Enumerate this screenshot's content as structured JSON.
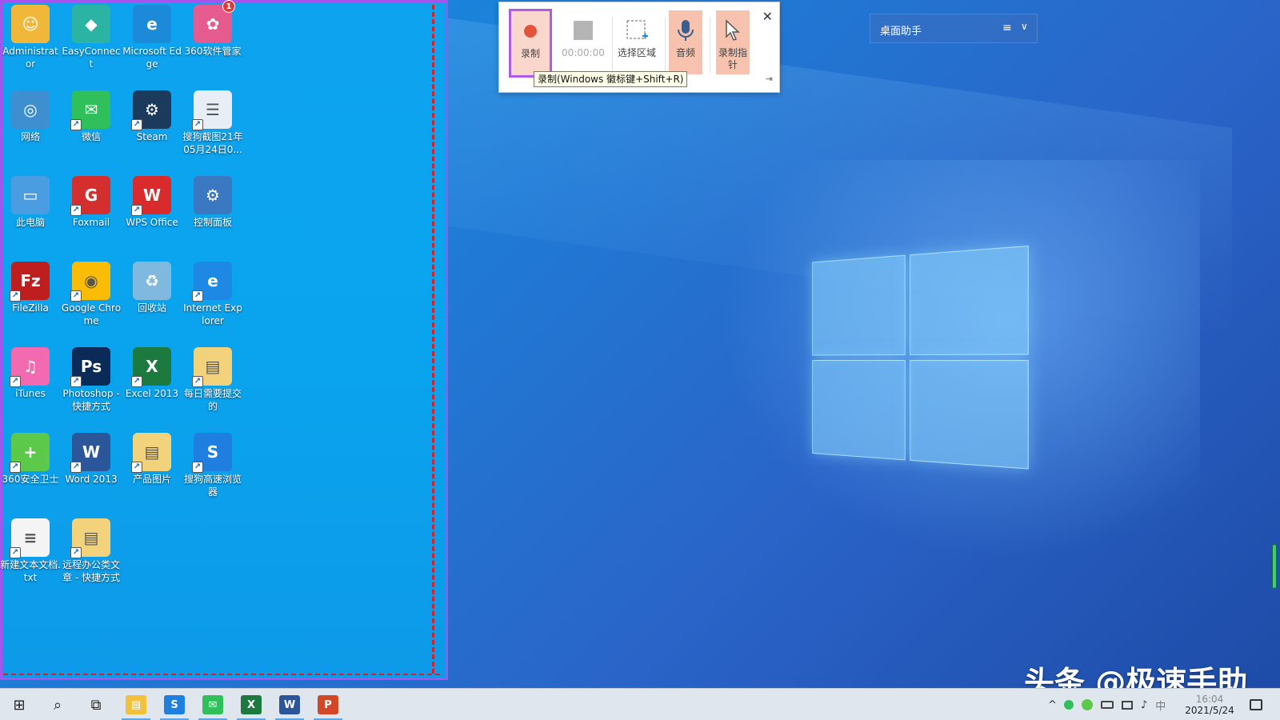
{
  "desktop": {
    "icons": [
      {
        "label": "Administrator",
        "color": "#f0b73a",
        "glyph": "☺"
      },
      {
        "label": "EasyConnect",
        "color": "#2bb3a3",
        "glyph": "◆"
      },
      {
        "label": "Microsoft Edge",
        "color": "#1b8ad8",
        "glyph": "e"
      },
      {
        "label": "360软件管家",
        "color": "#e55a8f",
        "glyph": "✿",
        "badge": "1"
      },
      {
        "label": "网络",
        "color": "#3d8fd0",
        "glyph": "◎"
      },
      {
        "label": "微信",
        "color": "#2fc05b",
        "glyph": "✉"
      },
      {
        "label": "Steam",
        "color": "#1b3a5c",
        "glyph": "⚙"
      },
      {
        "label": "搜狗截图21年05月24日0...",
        "color": "#e8eef5",
        "glyph": "☰"
      },
      {
        "label": "此电脑",
        "color": "#4a9de0",
        "glyph": "▭"
      },
      {
        "label": "Foxmail",
        "color": "#d32f2f",
        "glyph": "G"
      },
      {
        "label": "WPS Office",
        "color": "#d92b2b",
        "glyph": "W"
      },
      {
        "label": "控制面板",
        "color": "#3a78c2",
        "glyph": "⚙"
      },
      {
        "label": "FileZilla",
        "color": "#bf1e1e",
        "glyph": "Fz"
      },
      {
        "label": "Google Chrome",
        "color": "#fbbc05",
        "glyph": "◉"
      },
      {
        "label": "回收站",
        "color": "#7fb9e0",
        "glyph": "♻"
      },
      {
        "label": "Internet Explorer",
        "color": "#1e88e5",
        "glyph": "e"
      },
      {
        "label": "iTunes",
        "color": "#f26ab0",
        "glyph": "♫"
      },
      {
        "label": "Photoshop - 快捷方式",
        "color": "#0a2a57",
        "glyph": "Ps"
      },
      {
        "label": "Excel 2013",
        "color": "#1d7a3f",
        "glyph": "X"
      },
      {
        "label": "每日需要提交的",
        "color": "#f2d27a",
        "glyph": "▤"
      },
      {
        "label": "360安全卫士",
        "color": "#5cc94a",
        "glyph": "+"
      },
      {
        "label": "Word 2013",
        "color": "#2b579a",
        "glyph": "W"
      },
      {
        "label": "产品图片",
        "color": "#f2d27a",
        "glyph": "▤"
      },
      {
        "label": "搜狗高速浏览器",
        "color": "#1e7fe0",
        "glyph": "S"
      },
      {
        "label": "新建文本文档.txt",
        "color": "#f4f4f4",
        "glyph": "≡"
      },
      {
        "label": "远程办公类文章 - 快捷方式",
        "color": "#f2d27a",
        "glyph": "▤"
      }
    ]
  },
  "recorder": {
    "record_label": "录制",
    "timer": "00:00:00",
    "region_label": "选择区域",
    "audio_label": "音频",
    "pointer_label": "录制指针",
    "close": "✕",
    "pin": "⇥",
    "tooltip": "录制(Windows 徽标键+Shift+R)"
  },
  "assistant": {
    "title": "桌面助手",
    "menu_icon": "≡",
    "chevron": "∨"
  },
  "watermark": "头条 @极速手助",
  "taskbar": {
    "start": "⊞",
    "search": "⌕",
    "taskview": "⧉",
    "apps": [
      {
        "name": "file-explorer",
        "glyph": "▤",
        "color": "#f2c13c"
      },
      {
        "name": "sogou-browser",
        "glyph": "S",
        "color": "#1e7fe0"
      },
      {
        "name": "wechat",
        "glyph": "✉",
        "color": "#2fc05b"
      },
      {
        "name": "excel",
        "glyph": "X",
        "color": "#1d7a3f"
      },
      {
        "name": "word",
        "glyph": "W",
        "color": "#2b579a"
      },
      {
        "name": "powerpoint",
        "glyph": "P",
        "color": "#d24726"
      }
    ],
    "tray": {
      "chevron": "^",
      "ime": "中"
    },
    "clock": {
      "time": "16:04",
      "date": "2021/5/24"
    }
  }
}
